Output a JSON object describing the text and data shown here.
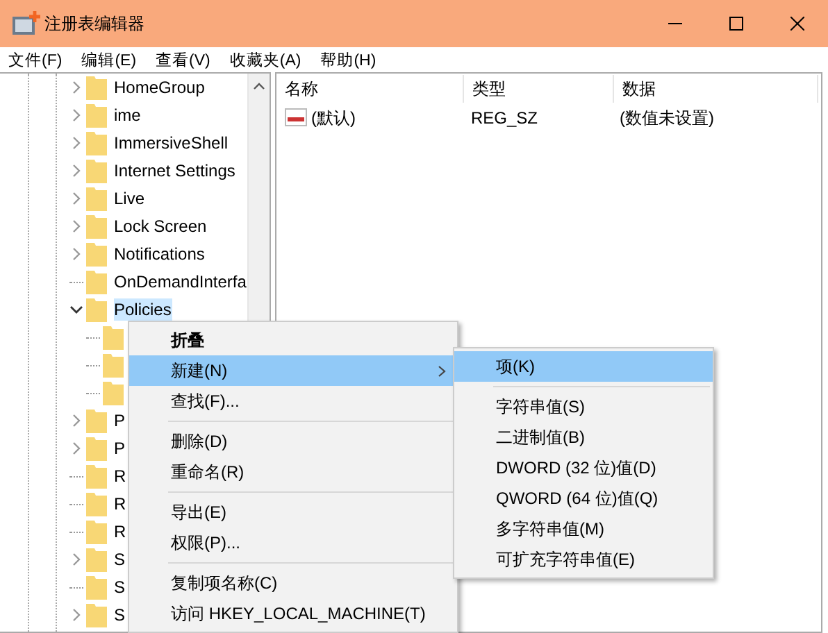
{
  "window": {
    "title": "注册表编辑器"
  },
  "menu_bar": [
    "文件(F)",
    "编辑(E)",
    "查看(V)",
    "收藏夹(A)",
    "帮助(H)"
  ],
  "tree": [
    {
      "kind": "branch",
      "label": "HomeGroup",
      "expanded": false,
      "selected": false
    },
    {
      "kind": "branch",
      "label": "ime",
      "expanded": false,
      "selected": false
    },
    {
      "kind": "branch",
      "label": "ImmersiveShell",
      "expanded": false,
      "selected": false
    },
    {
      "kind": "branch",
      "label": "Internet Settings",
      "expanded": false,
      "selected": false
    },
    {
      "kind": "branch",
      "label": "Live",
      "expanded": false,
      "selected": false
    },
    {
      "kind": "branch",
      "label": "Lock Screen",
      "expanded": false,
      "selected": false
    },
    {
      "kind": "branch",
      "label": "Notifications",
      "expanded": false,
      "selected": false
    },
    {
      "kind": "leaf",
      "label": "OnDemandInterfa",
      "selected": false
    },
    {
      "kind": "branch",
      "label": "Policies",
      "expanded": true,
      "selected": true,
      "children": [
        {
          "kind": "folder"
        },
        {
          "kind": "folder"
        },
        {
          "kind": "folder"
        }
      ]
    },
    {
      "kind": "branch",
      "label": "P",
      "expanded": false,
      "selected": false
    },
    {
      "kind": "branch",
      "label": "P",
      "expanded": false,
      "selected": false
    },
    {
      "kind": "leaf",
      "label": "R",
      "selected": false
    },
    {
      "kind": "leaf",
      "label": "R",
      "selected": false
    },
    {
      "kind": "leaf",
      "label": "R",
      "selected": false
    },
    {
      "kind": "branch",
      "label": "S",
      "expanded": false,
      "selected": false
    },
    {
      "kind": "leaf",
      "label": "S",
      "selected": false
    },
    {
      "kind": "branch",
      "label": "S",
      "expanded": false,
      "selected": false
    }
  ],
  "list": {
    "columns": [
      "名称",
      "类型",
      "数据"
    ],
    "rows": [
      {
        "name": "(默认)",
        "type": "REG_SZ",
        "data": "(数值未设置)"
      }
    ]
  },
  "context_menu": [
    {
      "kind": "default",
      "label": "折叠",
      "selected": false,
      "submenu": false
    },
    {
      "kind": "item",
      "label": "新建(N)",
      "selected": true,
      "submenu": true
    },
    {
      "kind": "item",
      "label": "查找(F)...",
      "selected": false,
      "submenu": false
    },
    {
      "kind": "separator"
    },
    {
      "kind": "item",
      "label": "删除(D)",
      "selected": false,
      "submenu": false
    },
    {
      "kind": "item",
      "label": "重命名(R)",
      "selected": false,
      "submenu": false
    },
    {
      "kind": "separator"
    },
    {
      "kind": "item",
      "label": "导出(E)",
      "selected": false,
      "submenu": false
    },
    {
      "kind": "item",
      "label": "权限(P)...",
      "selected": false,
      "submenu": false
    },
    {
      "kind": "separator"
    },
    {
      "kind": "item",
      "label": "复制项名称(C)",
      "selected": false,
      "submenu": false
    },
    {
      "kind": "item",
      "label": "访问 HKEY_LOCAL_MACHINE(T)",
      "selected": false,
      "submenu": false
    }
  ],
  "submenu": [
    {
      "kind": "item",
      "label": "项(K)",
      "selected": true,
      "submenu": false
    },
    {
      "kind": "separator"
    },
    {
      "kind": "item",
      "label": "字符串值(S)",
      "selected": false,
      "submenu": false
    },
    {
      "kind": "item",
      "label": "二进制值(B)",
      "selected": false,
      "submenu": false
    },
    {
      "kind": "item",
      "label": "DWORD (32 位)值(D)",
      "selected": false,
      "submenu": false
    },
    {
      "kind": "item",
      "label": "QWORD (64 位)值(Q)",
      "selected": false,
      "submenu": false
    },
    {
      "kind": "item",
      "label": "多字符串值(M)",
      "selected": false,
      "submenu": false
    },
    {
      "kind": "item",
      "label": "可扩充字符串值(E)",
      "selected": false,
      "submenu": false
    }
  ]
}
